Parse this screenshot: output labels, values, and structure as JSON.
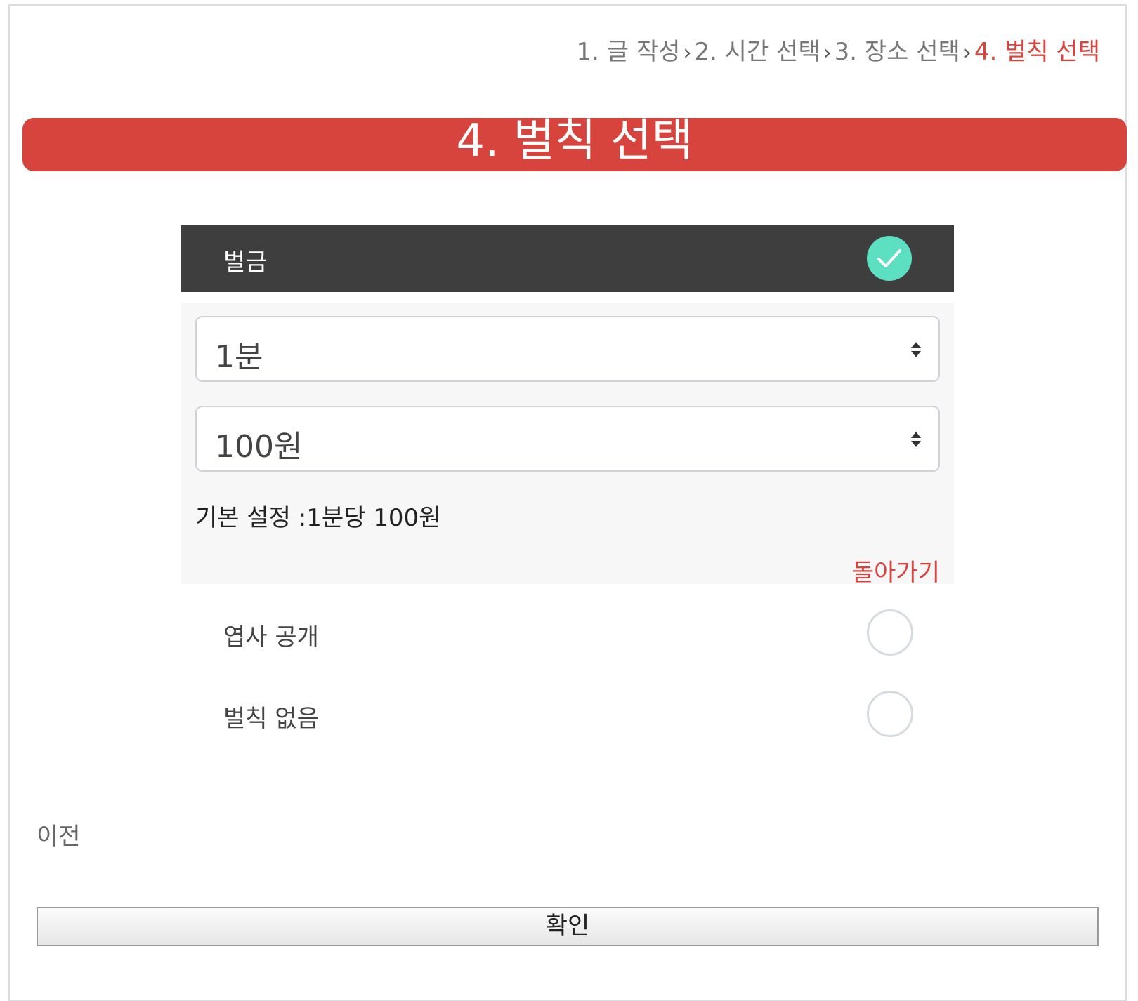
{
  "breadcrumb": {
    "step1": "1. 글 작성",
    "step2": "2. 시간 선택",
    "step3": "3. 장소 선택",
    "step4": "4. 벌칙 선택",
    "separator": "›"
  },
  "title": "4. 벌칙 선택",
  "fine_option": {
    "label": "벌금",
    "selected": true,
    "icon": "check-icon",
    "time_select_value": "1분",
    "amount_select_value": "100원",
    "default_text": "기본 설정 :1분당 100원",
    "back_link": "돌아가기"
  },
  "other_options": [
    {
      "label": "엽사 공개",
      "selected": false
    },
    {
      "label": "벌칙 없음",
      "selected": false
    }
  ],
  "prev_label": "이전",
  "confirm_label": "확인",
  "colors": {
    "accent": "#d7443e",
    "header_dark": "#3e3e3e",
    "check": "#5ddfc2"
  }
}
